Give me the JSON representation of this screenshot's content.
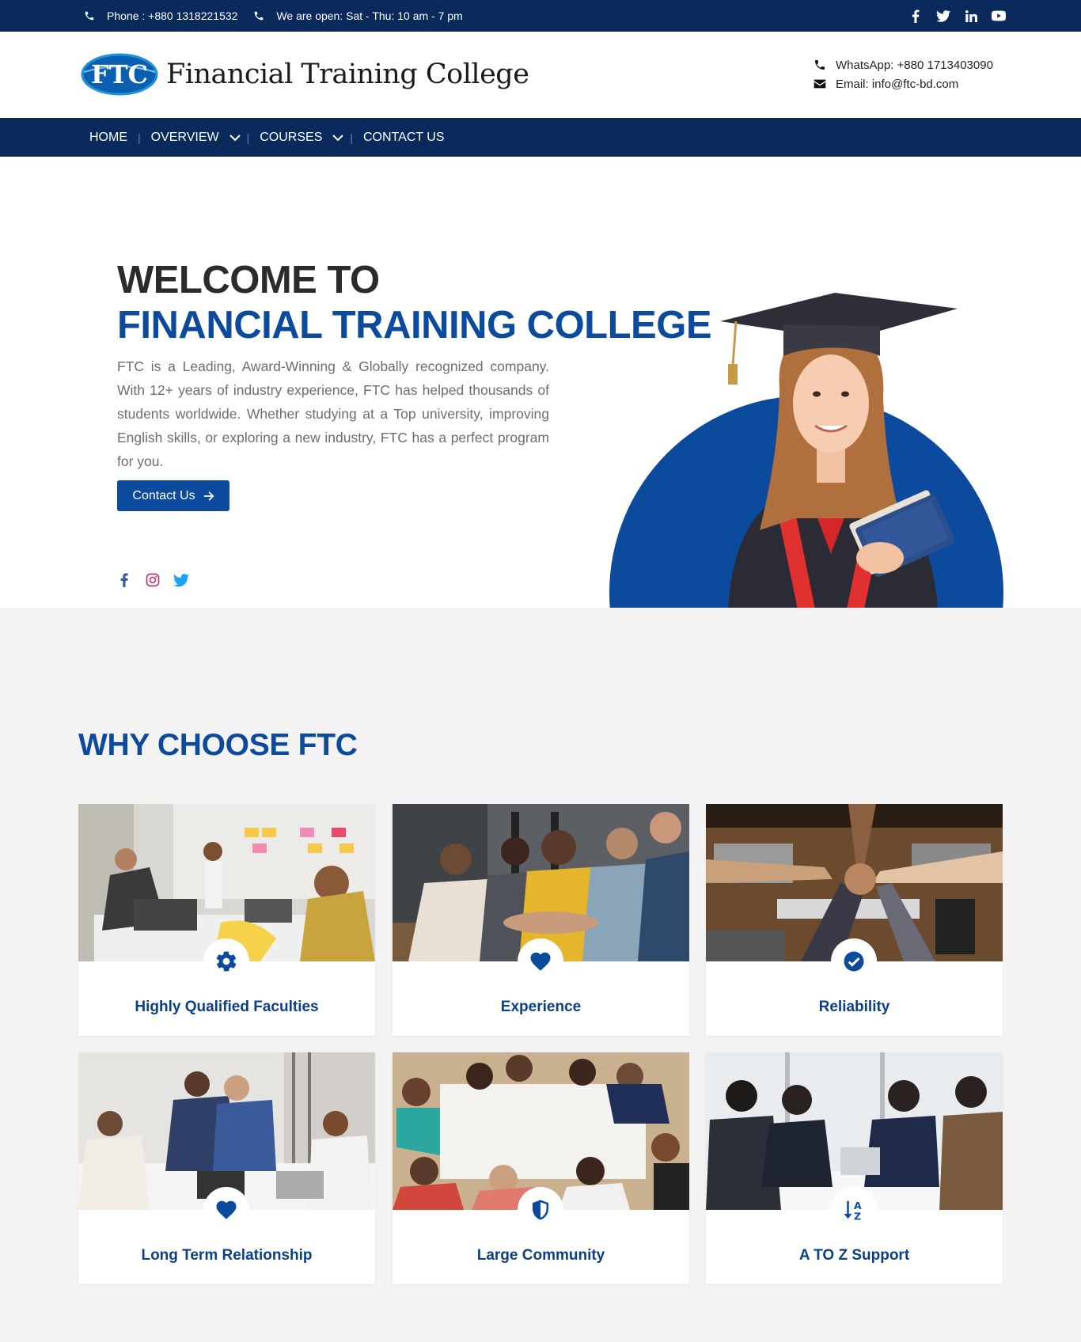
{
  "topbar": {
    "phone": "Phone : +880 1318221532",
    "hours": "We are open: Sat - Thu: 10 am - 7 pm",
    "social": [
      "facebook-icon",
      "twitter-icon",
      "linkedin-icon",
      "youtube-icon"
    ]
  },
  "header": {
    "logo_mark": "FTC",
    "logo_text": "Financial Training College",
    "whatsapp": "WhatsApp: +880 1713403090",
    "email": "Email: info@ftc-bd.com"
  },
  "nav": {
    "items": [
      {
        "label": "HOME"
      },
      {
        "label": "OVERVIEW"
      },
      {
        "label": "COURSES"
      },
      {
        "label": "CONTACT US"
      }
    ]
  },
  "hero": {
    "title_line1": "WELCOME TO",
    "title_line2": "FINANCIAL TRAINING COLLEGE",
    "description": "FTC is a Leading, Award-Winning & Globally recognized company. With 12+ years of industry experience, FTC has helped thousands of students worldwide. Whether studying at a Top university, improving English skills, or exploring a new industry, FTC has a perfect program for you.",
    "button_label": "Contact Us",
    "social": [
      "facebook-icon",
      "instagram-icon",
      "twitter-icon"
    ]
  },
  "why": {
    "heading": "WHY CHOOSE FTC",
    "cards": [
      {
        "title": "Highly Qualified Faculties",
        "icon": "gear-icon"
      },
      {
        "title": "Experience",
        "icon": "heart-icon"
      },
      {
        "title": "Reliability",
        "icon": "check-circle-icon"
      },
      {
        "title": "Long Term Relationship",
        "icon": "heart-icon"
      },
      {
        "title": "Large Community",
        "icon": "shield-icon"
      },
      {
        "title": "A TO Z Support",
        "icon": "sort-alpha-icon"
      }
    ]
  },
  "colors": {
    "navy": "#0a2a5c",
    "brand_blue": "#0b4a9c",
    "section_bg": "#f4f3f4"
  }
}
